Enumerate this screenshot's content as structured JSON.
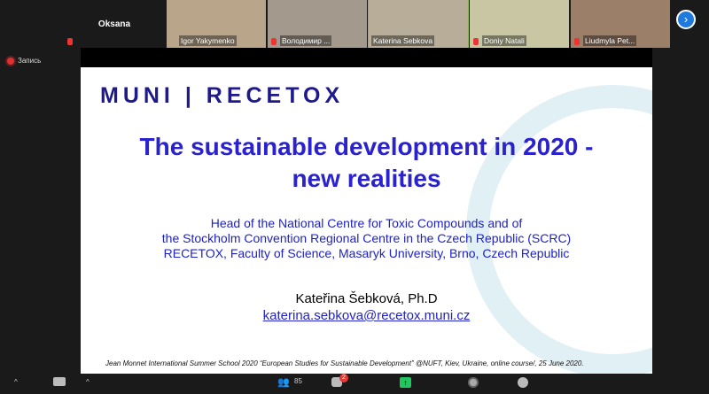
{
  "participants": [
    {
      "name": "Oksana",
      "video": false,
      "muted": true
    },
    {
      "name": "Igor Yakymenko",
      "muted": false
    },
    {
      "name": "Володимир ...",
      "muted": true
    },
    {
      "name": "Katerina Sebkova",
      "muted": false,
      "active": true
    },
    {
      "name": "Doniy Natali",
      "muted": true
    },
    {
      "name": "Liudmyla Pet...",
      "muted": true
    }
  ],
  "recording_label": "Запись",
  "slide": {
    "logo": "MUNI | RECETOX",
    "title_line1": "The sustainable development in 2020 -",
    "title_line2": "new realities",
    "sub1": "Head of the National Centre for Toxic Compounds and of",
    "sub2": "the Stockholm Convention Regional Centre in the Czech Republic (SCRC)",
    "sub3": "RECETOX, Faculty of Science, Masaryk University, Brno, Czech Republic",
    "author": "Kateřina Šebková, Ph.D",
    "email": "katerina.sebkova@recetox.muni.cz",
    "footer": "Jean Monnet International Summer School 2020 “European Studies for Sustainable Development” @NUFT, Kiev, Ukraine, online course/, 25 June 2020."
  },
  "toolbar": {
    "participants_count": "85",
    "chat_badge": "2"
  },
  "colors": {
    "title": "#2a22cc",
    "logo": "#1e1a8c",
    "share": "#22c55e",
    "badge": "#e53935"
  }
}
